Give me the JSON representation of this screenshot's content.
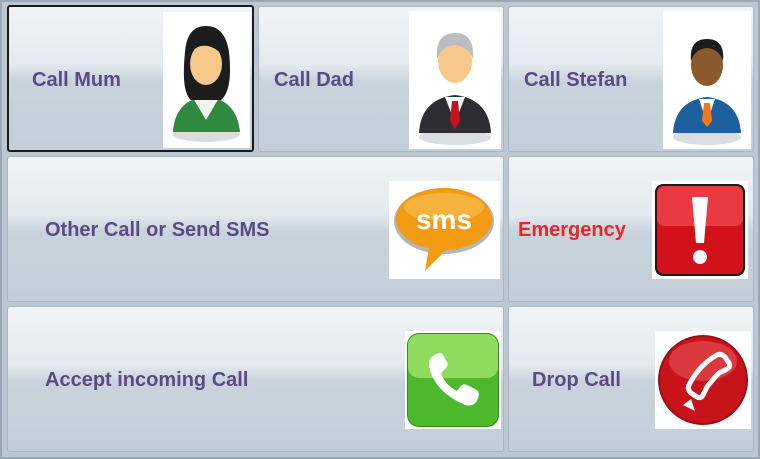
{
  "tiles": {
    "call_mum": {
      "label": "Call Mum",
      "icon": "woman-avatar-icon"
    },
    "call_dad": {
      "label": "Call Dad",
      "icon": "man-grey-hair-avatar-icon"
    },
    "call_stefan": {
      "label": "Call Stefan",
      "icon": "man-dark-skin-avatar-icon"
    },
    "other_call_sms": {
      "label": "Other Call or Send SMS",
      "icon": "sms-bubble-icon",
      "icon_text": "sms"
    },
    "emergency": {
      "label": "Emergency",
      "icon": "exclamation-warning-icon",
      "label_color": "#e8252b"
    },
    "accept_call": {
      "label": "Accept incoming Call",
      "icon": "green-phone-icon"
    },
    "drop_call": {
      "label": "Drop Call",
      "icon": "red-phone-hangup-icon"
    }
  },
  "colors": {
    "label": "#5b4a86",
    "emergency": "#e8252b",
    "accept_green": "#44b12a",
    "drop_red": "#c8131b",
    "sms_orange": "#f29a12"
  }
}
